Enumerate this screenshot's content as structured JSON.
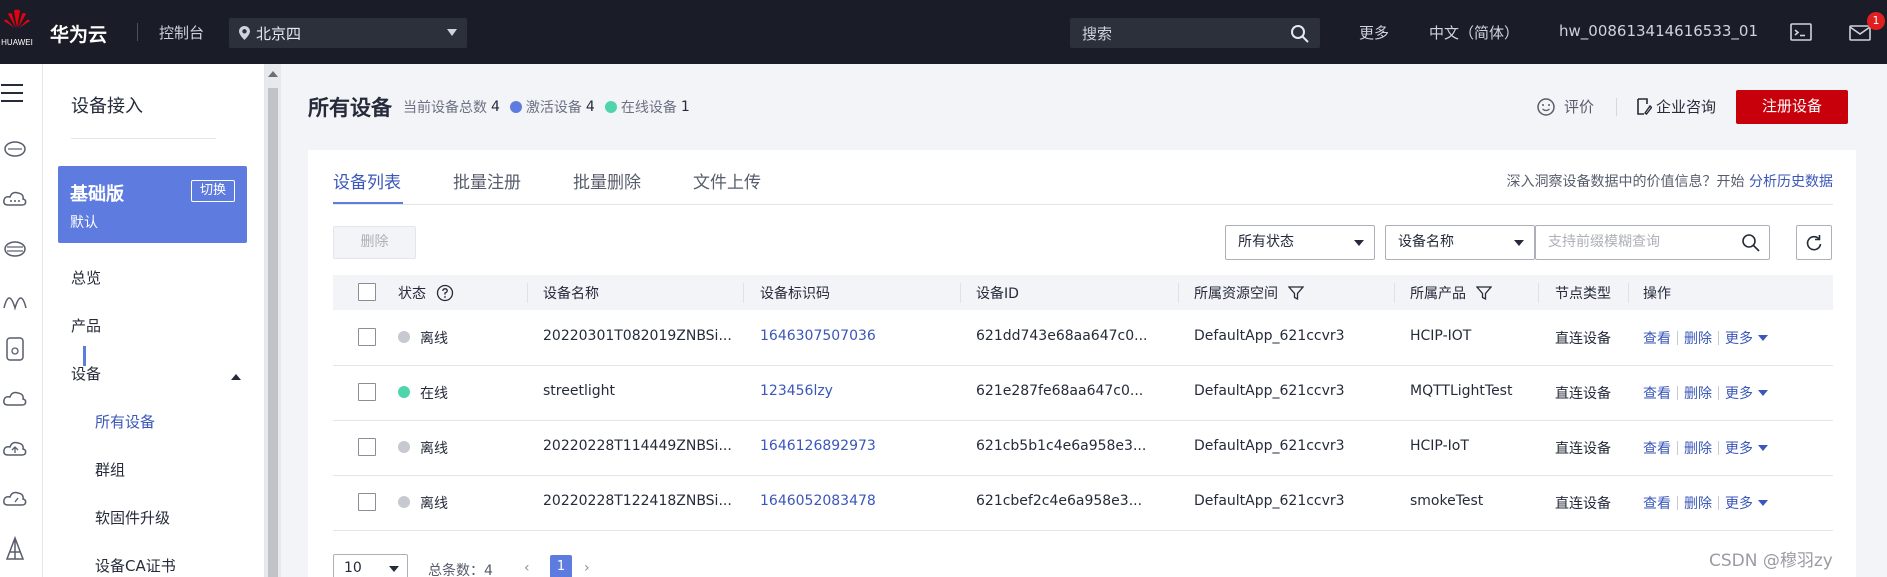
{
  "topbar": {
    "logo_caption": "HUAWEI",
    "brand": "华为云",
    "console": "控制台",
    "region": "北京四",
    "search_placeholder": "搜索",
    "more": "更多",
    "language": "中文（简体）",
    "account": "hw_008613414616533_01",
    "notification_count": "1"
  },
  "sidebar": {
    "title": "设备接入",
    "plan_name": "基础版",
    "plan_sub": "默认",
    "plan_switch": "切换",
    "items": [
      "总览",
      "产品",
      "设备"
    ],
    "sub_items": [
      "所有设备",
      "群组",
      "软固件升级",
      "设备CA证书"
    ]
  },
  "header": {
    "title": "所有设备",
    "total_label": "当前设备总数",
    "total_value": "4",
    "active_label": "激活设备",
    "active_value": "4",
    "online_label": "在线设备",
    "online_value": "1",
    "review": "评价",
    "consult": "企业咨询",
    "register": "注册设备"
  },
  "tabs": [
    "设备列表",
    "批量注册",
    "批量删除",
    "文件上传"
  ],
  "insight_text": "深入洞察设备数据中的价值信息？开始",
  "insight_link": "分析历史数据",
  "toolbar": {
    "delete": "删除",
    "status_filter": "所有状态",
    "field_filter": "设备名称",
    "query_placeholder": "支持前缀模糊查询"
  },
  "table": {
    "headers": [
      "状态",
      "设备名称",
      "设备标识码",
      "设备ID",
      "所属资源空间",
      "所属产品",
      "节点类型",
      "操作"
    ],
    "rows": [
      {
        "status": "离线",
        "name": "20220301T082019ZNBSi...",
        "code": "1646307507036",
        "id": "621dd743e68aa647c0...",
        "space": "DefaultApp_621ccvr3",
        "product": "HCIP-IOT",
        "node": "直连设备"
      },
      {
        "status": "在线",
        "name": "streetlight",
        "code": "123456lzy",
        "id": "621e287fe68aa647c0...",
        "space": "DefaultApp_621ccvr3",
        "product": "MQTTLightTest",
        "node": "直连设备"
      },
      {
        "status": "离线",
        "name": "20220228T114449ZNBSi...",
        "code": "1646126892973",
        "id": "621cb5b1c4e6a958e3...",
        "space": "DefaultApp_621ccvr3",
        "product": "HCIP-IoT",
        "node": "直连设备"
      },
      {
        "status": "离线",
        "name": "20220228T122418ZNBSi...",
        "code": "1646052083478",
        "id": "621cbef2c4e6a958e3...",
        "space": "DefaultApp_621ccvr3",
        "product": "smokeTest",
        "node": "直连设备"
      }
    ],
    "ops": [
      "查看",
      "删除",
      "更多"
    ]
  },
  "pagination": {
    "page_size": "10",
    "total_label": "总条数：",
    "total": "4",
    "current": "1"
  },
  "watermark": "CSDN @穆羽zy",
  "colors": {
    "accent": "#5e7ce0",
    "brand_red": "#c7000b",
    "online": "#50d4ab",
    "offline": "#c7c9d1",
    "active": "#5e7ce0"
  }
}
